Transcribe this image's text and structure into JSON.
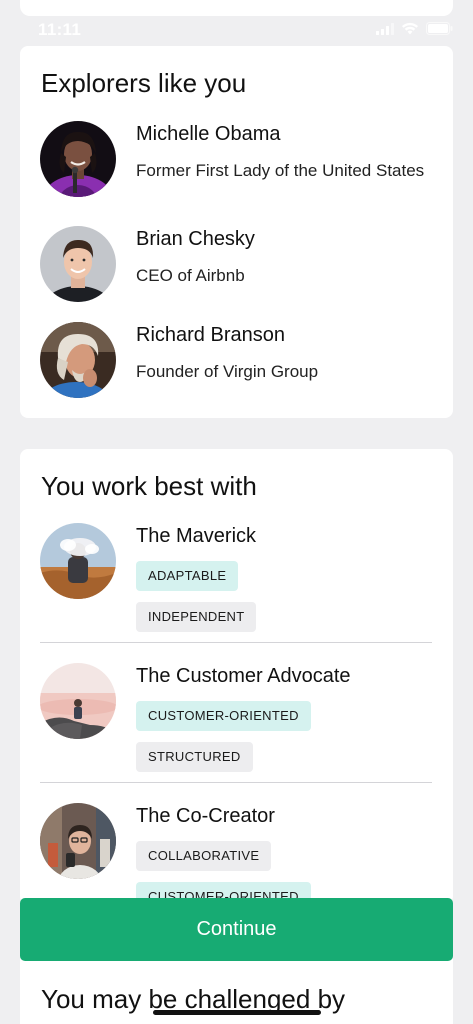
{
  "status_bar": {
    "time": "11:11",
    "icons": [
      "signal-icon",
      "wifi-icon",
      "battery-icon"
    ]
  },
  "explorers": {
    "title": "Explorers like you",
    "people": [
      {
        "name": "Michelle Obama",
        "role": "Former First Lady of the United States",
        "avatar": "michelle-obama-avatar"
      },
      {
        "name": "Brian Chesky",
        "role": "CEO of Airbnb",
        "avatar": "brian-chesky-avatar"
      },
      {
        "name": "Richard Branson",
        "role": "Founder of Virgin Group",
        "avatar": "richard-branson-avatar"
      }
    ]
  },
  "work_best": {
    "title": "You work best with",
    "personas": [
      {
        "name": "The Maverick",
        "tags": [
          "ADAPTABLE",
          "INDEPENDENT"
        ]
      },
      {
        "name": "The Customer Advocate",
        "tags": [
          "CUSTOMER-ORIENTED",
          "STRUCTURED"
        ]
      },
      {
        "name": "The Co-Creator",
        "tags": [
          "COLLABORATIVE",
          "CUSTOMER-ORIENTED"
        ]
      }
    ]
  },
  "continue_button": {
    "label": "Continue"
  },
  "challenged": {
    "title": "You may be challenged by"
  },
  "colors": {
    "accent_green": "#17ab73",
    "tag_teal": "#d5f2ef",
    "tag_gray": "#ededef",
    "page_background": "#efeff1"
  }
}
